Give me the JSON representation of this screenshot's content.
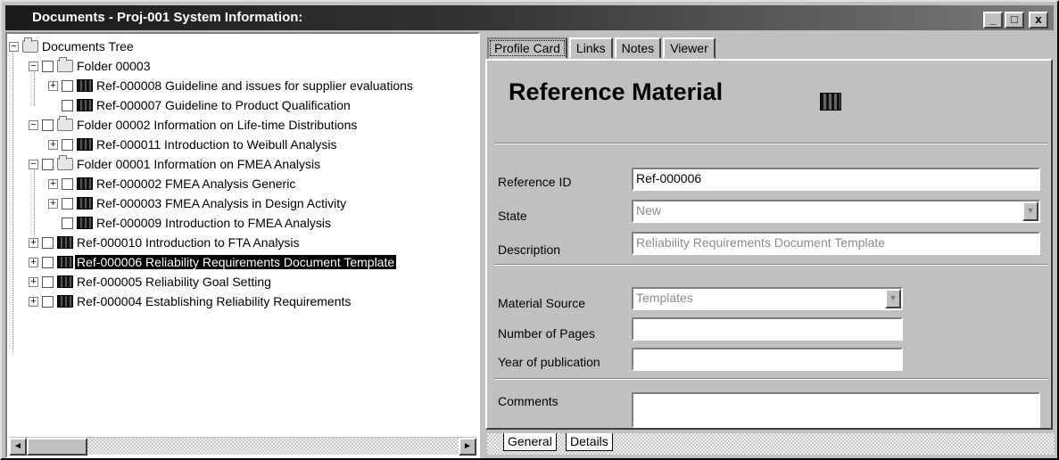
{
  "window": {
    "title": "Documents - Proj-001 System Information:",
    "minimize_label": "_",
    "maximize_label": "□",
    "close_label": "x"
  },
  "tree": {
    "root_label": "Documents Tree",
    "items": [
      {
        "label": "Folder 00003",
        "type": "folder"
      },
      {
        "label": "Ref-000008 Guideline and issues for supplier evaluations",
        "type": "ref"
      },
      {
        "label": "Ref-000007 Guideline to Product Qualification",
        "type": "ref"
      },
      {
        "label": "Folder 00002 Information on Life-time Distributions",
        "type": "folder"
      },
      {
        "label": "Ref-000011 Introduction to Weibull Analysis",
        "type": "ref"
      },
      {
        "label": "Folder 00001 Information on FMEA Analysis",
        "type": "folder"
      },
      {
        "label": "Ref-000002 FMEA Analysis Generic",
        "type": "ref"
      },
      {
        "label": "Ref-000003 FMEA Analysis in Design Activity",
        "type": "ref"
      },
      {
        "label": "Ref-000009 Introduction to FMEA Analysis",
        "type": "ref"
      },
      {
        "label": "Ref-000010 Introduction to FTA Analysis",
        "type": "ref"
      },
      {
        "label": "Ref-000006 Reliability Requirements Document Template",
        "type": "ref",
        "selected": true
      },
      {
        "label": "Ref-000005 Reliability Goal Setting",
        "type": "ref"
      },
      {
        "label": "Ref-000004 Establishing Reliability Requirements",
        "type": "ref"
      }
    ],
    "scroll_left": "◄",
    "scroll_right": "►"
  },
  "tabs": {
    "profile_card": "Profile Card",
    "links": "Links",
    "notes": "Notes",
    "viewer": "Viewer"
  },
  "card": {
    "title": "Reference Material",
    "reference_id_label": "Reference ID",
    "reference_id_value": "Ref-000006",
    "state_label": "State",
    "state_value": "New",
    "description_label": "Description",
    "description_value": "Reliability Requirements Document Template",
    "material_source_label": "Material Source",
    "material_source_value": "Templates",
    "pages_label": "Number of Pages",
    "pages_value": "",
    "year_label": "Year of publication",
    "year_value": "",
    "comments_label": "Comments",
    "comments_value": ""
  },
  "bottom_tabs": {
    "general": "General",
    "details": "Details"
  }
}
